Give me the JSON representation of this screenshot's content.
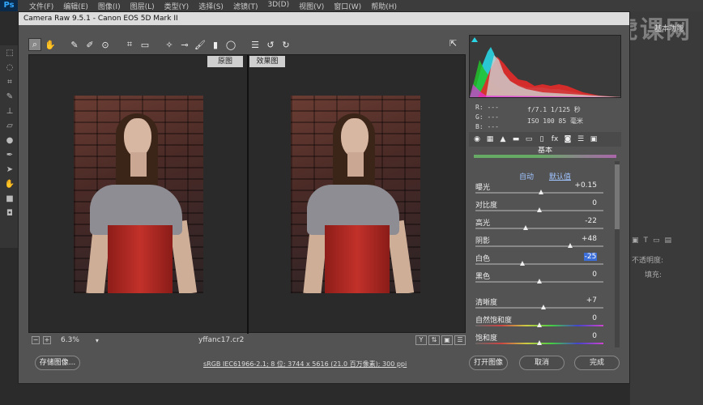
{
  "app": {
    "logo": "Ps",
    "menus": [
      "文件(F)",
      "编辑(E)",
      "图像(I)",
      "图层(L)",
      "类型(Y)",
      "选择(S)",
      "滤镜(T)",
      "3D(D)",
      "视图(V)",
      "窗口(W)",
      "帮助(H)"
    ],
    "essentials": "基本功能",
    "watermark": "虎课网",
    "opacity_label": "不透明度:",
    "fill_label": "填充:"
  },
  "dialog": {
    "title": "Camera Raw 9.5.1 - Canon EOS 5D Mark II",
    "before_label": "原图",
    "after_label": "效果图",
    "zoom": "6.3%",
    "filename": "yffanc17.cr2",
    "workflow": "sRGB IEC61966-2.1; 8 位; 3744 x 5616 (21.0 百万像素); 300 ppi",
    "buttons": {
      "save": "存储图像...",
      "open": "打开图像",
      "cancel": "取消",
      "done": "完成"
    }
  },
  "info": {
    "r": "R:  ---",
    "g": "G:  ---",
    "b": "B:  ---",
    "exif_line1": "f/7.1  1/125 秒",
    "exif_line2": "ISO 100  85 毫米"
  },
  "panel": {
    "title": "基本",
    "auto": "自动",
    "default": "默认值",
    "sliders": [
      {
        "label": "曝光",
        "value": "+0.15",
        "pos": 0.51
      },
      {
        "label": "对比度",
        "value": "0",
        "pos": 0.5
      },
      {
        "label": "高光",
        "value": "-22",
        "pos": 0.39
      },
      {
        "label": "阴影",
        "value": "+48",
        "pos": 0.74
      },
      {
        "label": "白色",
        "value": "-25",
        "pos": 0.37,
        "selected": true
      },
      {
        "label": "黑色",
        "value": "0",
        "pos": 0.5
      },
      {
        "label": "清晰度",
        "value": "+7",
        "pos": 0.53
      },
      {
        "label": "自然饱和度",
        "value": "0",
        "pos": 0.5
      },
      {
        "label": "饱和度",
        "value": "0",
        "pos": 0.5
      }
    ]
  }
}
